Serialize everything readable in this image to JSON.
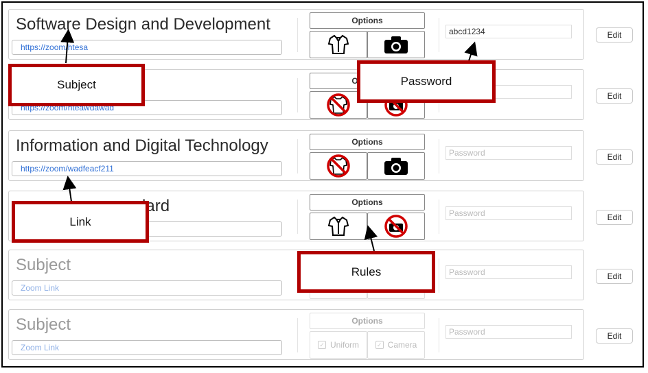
{
  "rows": [
    {
      "subject": "Software Design and Development",
      "link": "https://zoom/htesa",
      "options_label": "Options",
      "password": "abcd1234",
      "edit_label": "Edit"
    },
    {
      "subject": "",
      "link": "https://zoom/hteawdawad",
      "options_label": "Options",
      "password": "",
      "edit_label": "Edit"
    },
    {
      "subject": "Information and Digital Technology",
      "link": "https://zoom/wadfeacf211",
      "options_label": "Options",
      "password_placeholder": "Password",
      "edit_label": "Edit"
    },
    {
      "subject": "dard",
      "link": "",
      "options_label": "Options",
      "password_placeholder": "Password",
      "edit_label": "Edit"
    },
    {
      "subject_placeholder": "Subject",
      "link_placeholder": "Zoom Link",
      "password_placeholder": "Password",
      "edit_label": "Edit"
    },
    {
      "subject_placeholder": "Subject",
      "link_placeholder": "Zoom Link",
      "options_label": "Options",
      "uniform_label": "Uniform",
      "camera_label": "Camera",
      "password_placeholder": "Password",
      "edit_label": "Edit"
    }
  ],
  "callouts": {
    "subject": "Subject",
    "password": "Password",
    "link": "Link",
    "rules": "Rules"
  },
  "colors": {
    "callout_border": "#b00000",
    "link_text": "#2f6fd6"
  }
}
